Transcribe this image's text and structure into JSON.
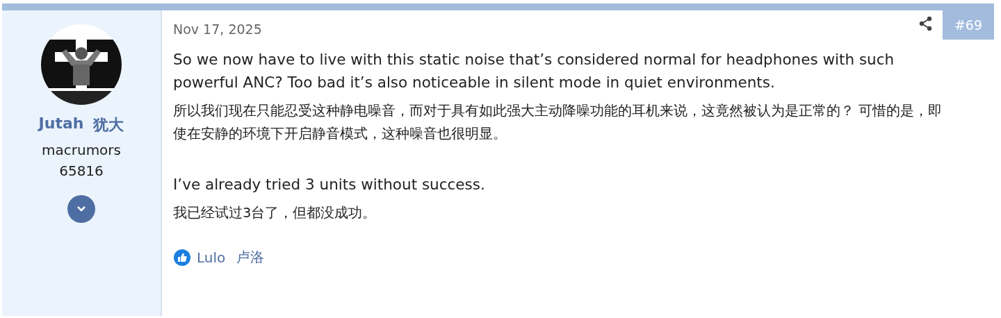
{
  "author": {
    "name": "Jutah",
    "name_translation": "犹大",
    "title": "macrumors",
    "title_extra": "65816"
  },
  "post": {
    "date": "Nov 17, 2025",
    "number": "#69",
    "sections": [
      {
        "paragraphs": [
          {
            "text": "So we now have to live with this static noise that’s considered normal for headphones with such powerful ANC? Too bad it’s also noticeable in silent mode in quiet environments.",
            "kind": "original"
          },
          {
            "text": "所以我们现在只能忍受这种静电噪音，而对于具有如此强大主动降噪功能的耳机来说，这竟然被认为是正常的？ 可惜的是，即使在安静的环境下开启静音模式，这种噪音也很明显。",
            "kind": "translation"
          }
        ]
      },
      {
        "paragraphs": [
          {
            "text": "I’ve already tried 3 units without success.",
            "kind": "original"
          },
          {
            "text": "我已经试过3台了，但都没成功。",
            "kind": "translation"
          }
        ]
      }
    ],
    "reactions": [
      {
        "name": "Lulo",
        "translation": "卢洛"
      }
    ]
  }
}
